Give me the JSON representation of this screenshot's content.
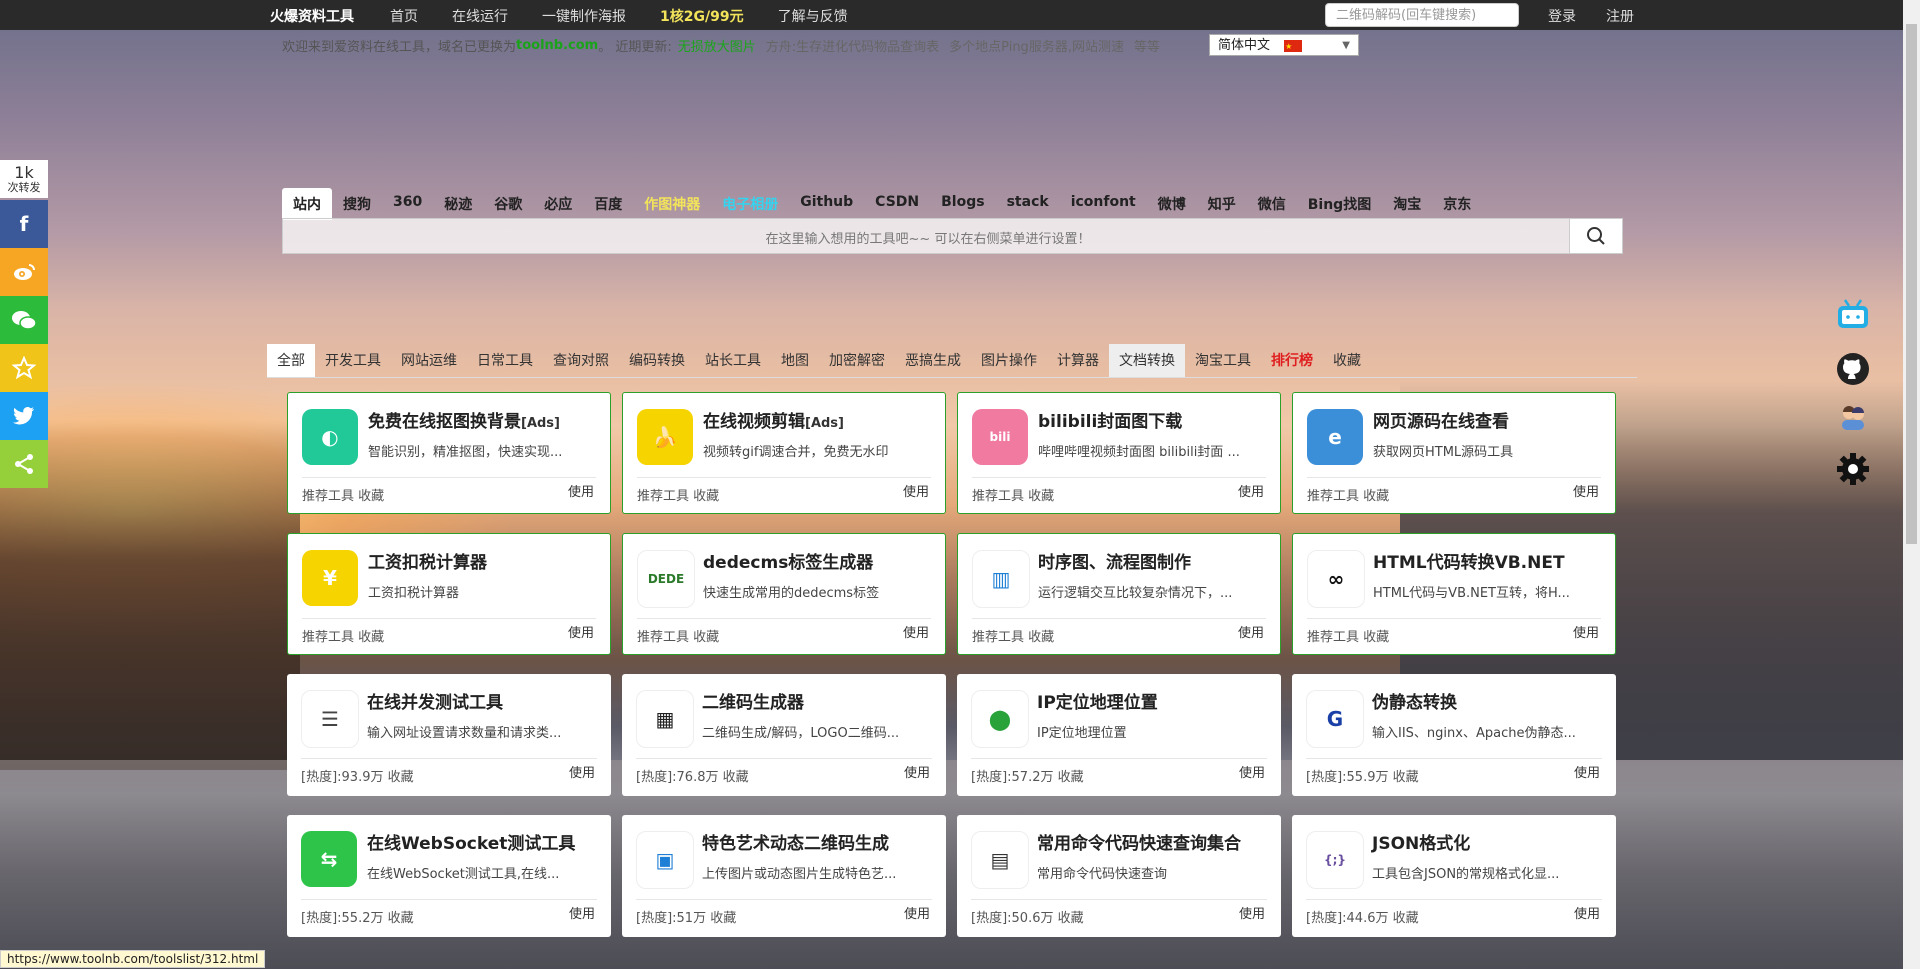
{
  "topnav": {
    "logo": "火爆资料工具",
    "items": [
      "首页",
      "在线运行",
      "一键制作海报",
      "1核2G/99元",
      "了解与反馈"
    ],
    "search_placeholder": "二维码解码(回车键搜索)",
    "login": "登录",
    "register": "注册"
  },
  "announce": {
    "welcome": "欢迎来到爱资料在线工具，域名已更换为",
    "domain": "toolnb.com",
    "recent": "。 近期更新:",
    "updates": [
      "无损放大图片",
      "方舟:生存进化代码物品查询表",
      "多个地点Ping服务器,网站测速",
      "等等"
    ]
  },
  "language": {
    "label": "简体中文"
  },
  "share": {
    "count": "1k",
    "count_label": "次转发"
  },
  "engines": [
    "站内",
    "搜狗",
    "360",
    "秘迹",
    "谷歌",
    "必应",
    "百度",
    "作图神器",
    "电子相册",
    "Github",
    "CSDN",
    "Blogs",
    "stack",
    "iconfont",
    "微博",
    "知乎",
    "微信",
    "Bing找图",
    "淘宝",
    "京东"
  ],
  "search": {
    "placeholder": "在这里输入想用的工具吧~~ 可以在右侧菜单进行设置！"
  },
  "categories": [
    "全部",
    "开发工具",
    "网站运维",
    "日常工具",
    "查询对照",
    "编码转换",
    "站长工具",
    "地图",
    "加密解密",
    "恶搞生成",
    "图片操作",
    "计算器",
    "文档转换",
    "淘宝工具",
    "排行榜",
    "收藏"
  ],
  "cards": [
    {
      "title": "免费在线抠图换背景",
      "tag": "[Ads]",
      "desc": "智能识别，精准抠图，快速实现...",
      "meta": "推荐工具 收藏",
      "use": "使用",
      "icon": "leaf-icon",
      "color": "#20c997"
    },
    {
      "title": "在线视频剪辑",
      "tag": "[Ads]",
      "desc": "视频转gif调速合并，免费无水印",
      "meta": "推荐工具 收藏",
      "use": "使用",
      "icon": "banana-icon",
      "color": "#f5d400"
    },
    {
      "title": "bilibili封面图下载",
      "tag": "",
      "desc": "哔哩哔哩视频封面图 bilibili封面 ...",
      "meta": "推荐工具 收藏",
      "use": "使用",
      "icon": "bilibili-icon",
      "color": "#f07aa0"
    },
    {
      "title": "网页源码在线查看",
      "tag": "",
      "desc": "获取网页HTML源码工具",
      "meta": "推荐工具 收藏",
      "use": "使用",
      "icon": "ie-browser-icon",
      "color": "#3b8ed8"
    },
    {
      "title": "工资扣税计算器",
      "tag": "",
      "desc": "工资扣税计算器",
      "meta": "推荐工具 收藏",
      "use": "使用",
      "icon": "money-bag-icon",
      "color": "#f5d400"
    },
    {
      "title": "dedecms标签生成器",
      "tag": "",
      "desc": "快速生成常用的dedecms标签",
      "meta": "推荐工具 收藏",
      "use": "使用",
      "icon": "dedecms-icon",
      "color": "#ffffff"
    },
    {
      "title": "时序图、流程图制作",
      "tag": "",
      "desc": "运行逻辑交互比较复杂情况下，...",
      "meta": "推荐工具 收藏",
      "use": "使用",
      "icon": "chart-bars-icon",
      "color": "#ffffff"
    },
    {
      "title": "HTML代码转换VB.NET",
      "tag": "",
      "desc": "HTML代码与VB.NET互转，将H...",
      "meta": "推荐工具 收藏",
      "use": "使用",
      "icon": "visual-basic-icon",
      "color": "#ffffff"
    },
    {
      "title": "在线并发测试工具",
      "tag": "",
      "desc": "输入网址设置请求数量和请求类...",
      "meta": "[热度]:93.9万 收藏",
      "use": "使用",
      "icon": "list-icon",
      "color": "#ffffff"
    },
    {
      "title": "二维码生成器",
      "tag": "",
      "desc": "二维码生成/解码，LOGO二维码...",
      "meta": "[热度]:76.8万 收藏",
      "use": "使用",
      "icon": "qrcode-icon",
      "color": "#ffffff"
    },
    {
      "title": "IP定位地理位置",
      "tag": "",
      "desc": "IP定位地理位置",
      "meta": "[热度]:57.2万 收藏",
      "use": "使用",
      "icon": "map-pin-icon",
      "color": "#ffffff"
    },
    {
      "title": "伪静态转换",
      "tag": "",
      "desc": "输入IIS、nginx、Apache伪静态...",
      "meta": "[热度]:55.9万 收藏",
      "use": "使用",
      "icon": "rewrite-g-icon",
      "color": "#ffffff"
    },
    {
      "title": "在线WebSocket测试工具",
      "tag": "",
      "desc": "在线WebSocket测试工具,在线...",
      "meta": "[热度]:55.2万 收藏",
      "use": "使用",
      "icon": "websocket-icon",
      "color": "#2ec44a"
    },
    {
      "title": "特色艺术动态二维码生成",
      "tag": "",
      "desc": "上传图片或动态图片生成特色艺...",
      "meta": "[热度]:51万 收藏",
      "use": "使用",
      "icon": "art-qrcode-icon",
      "color": "#ffffff"
    },
    {
      "title": "常用命令代码快速查询集合",
      "tag": "",
      "desc": "常用命令代码快速查询",
      "meta": "[热度]:50.6万 收藏",
      "use": "使用",
      "icon": "terminal-icon",
      "color": "#ffffff"
    },
    {
      "title": "JSON格式化",
      "tag": "",
      "desc": "工具包含JSON的常规格式化显...",
      "meta": "[热度]:44.6万 收藏",
      "use": "使用",
      "icon": "json-file-icon",
      "color": "#ffffff"
    }
  ],
  "status_url": "https://www.toolnb.com/toolslist/312.html"
}
